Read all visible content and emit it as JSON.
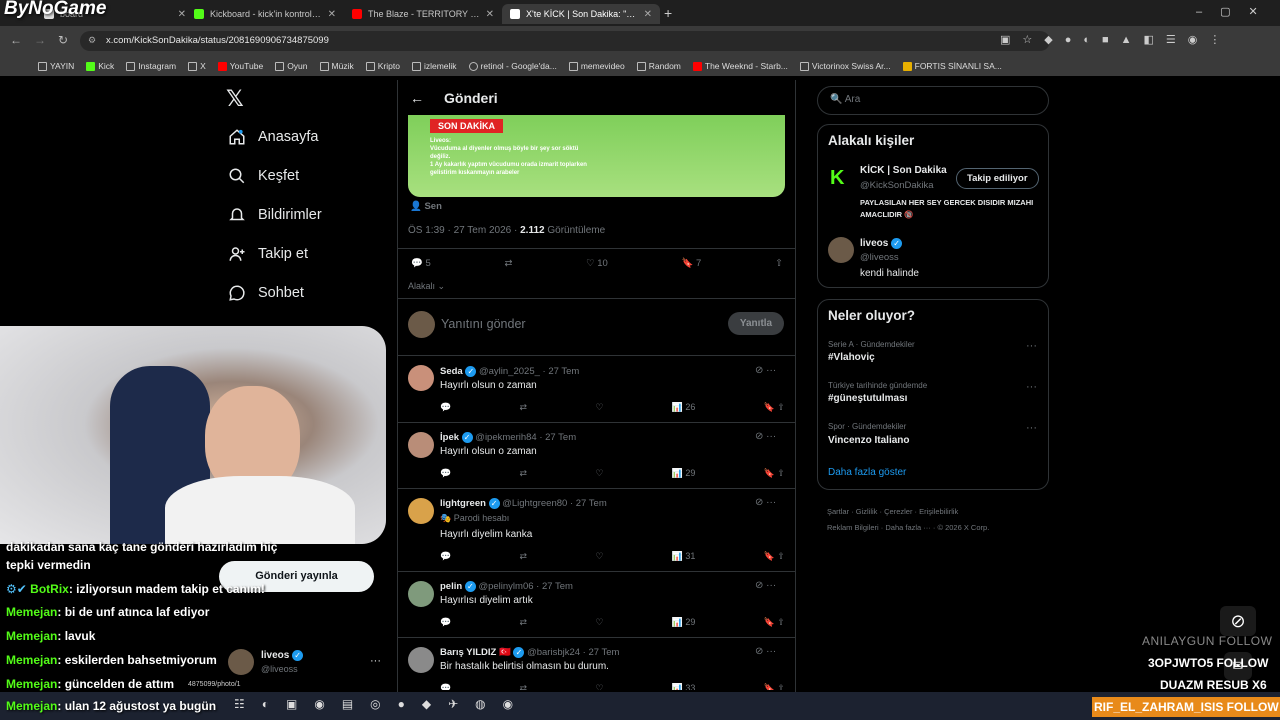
{
  "browser": {
    "tabs": [
      {
        "title": "board",
        "color": "#e0e0e0"
      },
      {
        "title": "Kickboard - kick'in kontrol pan",
        "color": "#53fc18"
      },
      {
        "title": "The Blaze - TERRITORY (Off",
        "color": "#ff0000"
      },
      {
        "title": "X'te KİCK | Son Dakika: \"SON D",
        "color": "#ffffff"
      }
    ],
    "url": "x.com/KickSonDakika/status/2081690906734875099",
    "bookmarks": [
      "YAYIN",
      "Kick",
      "Instagram",
      "X",
      "YouTube",
      "Oyun",
      "Müzik",
      "Kripto",
      "izlemelik",
      "retinol - Google'da...",
      "memevideo",
      "Random",
      "The Weeknd - Starb...",
      "Victorinox Swiss Ar...",
      "FORTIS SİNANLI SA..."
    ]
  },
  "x": {
    "nav": [
      "Anasayfa",
      "Keşfet",
      "Bildirimler",
      "Takip et",
      "Sohbet"
    ],
    "post_button": "Gönderi yayınla",
    "account": {
      "name": "liveos",
      "handle": "@liveoss"
    },
    "header": "Gönderi",
    "media": {
      "badge": "SON DAKİKA",
      "caption_lines": [
        "Liveos:",
        "Vücuduma al diyenler olmuş böyle bir şey sor söktü",
        "değiliz.",
        "1 Ay kakarlık yaptım vücudumu orada izmarit toplarken",
        "gelistirim kıskanmayın arabeler"
      ]
    },
    "poster_tag": "Sen",
    "meta": {
      "time": "ÖS 1:39 · 27 Tem 2026 ·",
      "views": "2.112",
      "views_label": "Görüntüleme"
    },
    "stats": {
      "replies": "5",
      "likes": "10",
      "bookmarks": "7"
    },
    "sort": "Alakalı",
    "reply_placeholder": "Yanıtını gönder",
    "reply_button": "Yanıtla",
    "replies": [
      {
        "name": "Seda",
        "handle": "@aylin_2025_ · 27 Tem",
        "text": "Hayırlı olsun o zaman",
        "views": "26",
        "color": "#c9907a",
        "flag": ""
      },
      {
        "name": "İpek",
        "handle": "@ipekmerih84 · 27 Tem",
        "text": "Hayırlı olsun o zaman",
        "views": "29",
        "color": "#b98d78",
        "flag": ""
      },
      {
        "name": "lightgreen",
        "handle": "@Lightgreen80 · 27 Tem",
        "text": "Hayırlı diyelim kanka",
        "views": "31",
        "color": "#d9a24a",
        "flag": "Parodi hesabı"
      },
      {
        "name": "pelin",
        "handle": "@pelinylm06 · 27 Tem",
        "text": "Hayırlısı diyelim artık",
        "views": "29",
        "color": "#7f9a7c",
        "flag": ""
      },
      {
        "name": "Barış YILDIZ 🇹🇷",
        "handle": "@barisbjk24 · 27 Tem",
        "text": "Bir hastalık belirtisi olmasın bu durum.",
        "views": "33",
        "color": "#8a8a8a",
        "flag": ""
      }
    ],
    "search_placeholder": "Ara",
    "related": {
      "title": "Alakalı kişiler",
      "people": [
        {
          "name": "KİCK | Son Dakika",
          "handle": "@KickSonDakika",
          "bio": "PAYLASILAN HER SEY GERCEK DISIDIR MIZAHI AMACLIDIR 🔞",
          "button": "Takip ediliyor"
        },
        {
          "name": "liveos",
          "handle": "@liveoss",
          "bio": "kendi halinde"
        }
      ]
    },
    "trends": {
      "title": "Neler oluyor?",
      "items": [
        {
          "ctx": "Serie A · Gündemdekiler",
          "name": "#Vlahoviç"
        },
        {
          "ctx": "Türkiye tarihinde gündemde",
          "name": "#güneştutulması"
        },
        {
          "ctx": "Spor · Gündemdekiler",
          "name": "Vincenzo Italiano"
        }
      ],
      "more": "Daha fazla göster"
    },
    "footer": [
      "Şartlar",
      "Gizlilik",
      "Çerezler",
      "Erişilebilirlik",
      "Reklam Bilgileri",
      "Daha fazla ···",
      "© 2026 X Corp."
    ]
  },
  "stream": {
    "logo": "ByNoGame",
    "chat": [
      {
        "user": "",
        "text": "dakikadan sana kaç tane gönderi hazırladım hiç"
      },
      {
        "user": "",
        "text": "tepki vermedin"
      },
      {
        "user": "BotRix",
        "text": ": izliyorsun madem takip et canım!"
      },
      {
        "user": "Memejan",
        "text": ": bi de unf atınca laf ediyor"
      },
      {
        "user": "Memejan",
        "text": ": lavuk"
      },
      {
        "user": "Memejan",
        "text": ": eskilerden bahsetmiyorum"
      },
      {
        "user": "Memejan",
        "text": ": güncelden de attım"
      },
      {
        "user": "Memejan",
        "text": ": ulan 12 ağustost ya bugün"
      }
    ],
    "overlay_lines": [
      "ANILAYGUN FOLLOW",
      "3OPJWTO5 FOLLOW",
      "DUAZM RESUB X6"
    ],
    "ticker": "RIF_EL_ZAHRAM_ISIS FOLLOW",
    "status_url": "4875099/photo/1"
  }
}
